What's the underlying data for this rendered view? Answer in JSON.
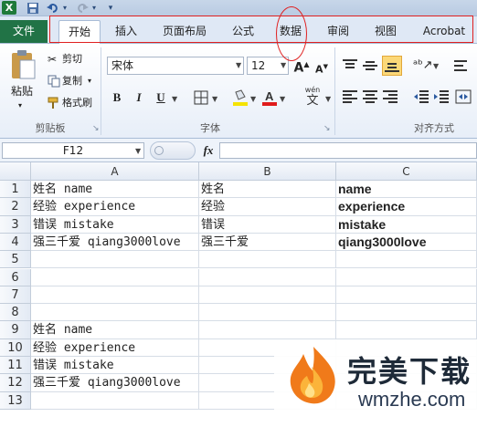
{
  "quick_access": {
    "logo": "X",
    "save_icon": "save-icon",
    "undo_icon": "undo-icon",
    "redo_icon": "redo-icon"
  },
  "tabs": [
    {
      "label": "文件"
    },
    {
      "label": "开始"
    },
    {
      "label": "插入"
    },
    {
      "label": "页面布局"
    },
    {
      "label": "公式"
    },
    {
      "label": "数据"
    },
    {
      "label": "审阅"
    },
    {
      "label": "视图"
    },
    {
      "label": "Acrobat"
    }
  ],
  "ribbon": {
    "clipboard": {
      "paste": "粘贴",
      "cut": "剪切",
      "copy": "复制",
      "format_painter": "格式刷",
      "group": "剪贴板"
    },
    "font": {
      "name": "宋体",
      "size": "12",
      "grow": "A",
      "shrink": "A",
      "bold": "B",
      "italic": "I",
      "underline": "U",
      "wen": "wén",
      "wen_char": "文",
      "group": "字体"
    },
    "alignment": {
      "group": "对齐方式"
    }
  },
  "formula_bar": {
    "name_box": "F12",
    "fx": "fx",
    "value": ""
  },
  "columns": [
    "A",
    "B",
    "C"
  ],
  "rows": [
    {
      "n": "1",
      "a": "姓名 name",
      "b": "姓名",
      "c": "name"
    },
    {
      "n": "2",
      "a": "经验 experience",
      "b": "经验",
      "c": "experience"
    },
    {
      "n": "3",
      "a": "错误 mistake",
      "b": "错误",
      "c": "mistake"
    },
    {
      "n": "4",
      "a": "强三千爱 qiang3000love",
      "b": "强三千爱",
      "c": "qiang3000love"
    },
    {
      "n": "5",
      "a": "",
      "b": "",
      "c": ""
    },
    {
      "n": "6",
      "a": "",
      "b": "",
      "c": ""
    },
    {
      "n": "7",
      "a": "",
      "b": "",
      "c": ""
    },
    {
      "n": "8",
      "a": "",
      "b": "",
      "c": ""
    },
    {
      "n": "9",
      "a": "姓名 name",
      "b": "",
      "c": ""
    },
    {
      "n": "10",
      "a": "经验 experience",
      "b": "",
      "c": ""
    },
    {
      "n": "11",
      "a": "错误 mistake",
      "b": "",
      "c": ""
    },
    {
      "n": "12",
      "a": "强三千爱 qiang3000love",
      "b": "",
      "c": ""
    },
    {
      "n": "13",
      "a": "",
      "b": "",
      "c": ""
    }
  ],
  "watermark": {
    "cn": "完美下载",
    "en": "wmzhe.com"
  },
  "colors": {
    "excel_green": "#217346",
    "annotation_red": "#e02020",
    "ribbon_blue": "#dfe8f5"
  }
}
